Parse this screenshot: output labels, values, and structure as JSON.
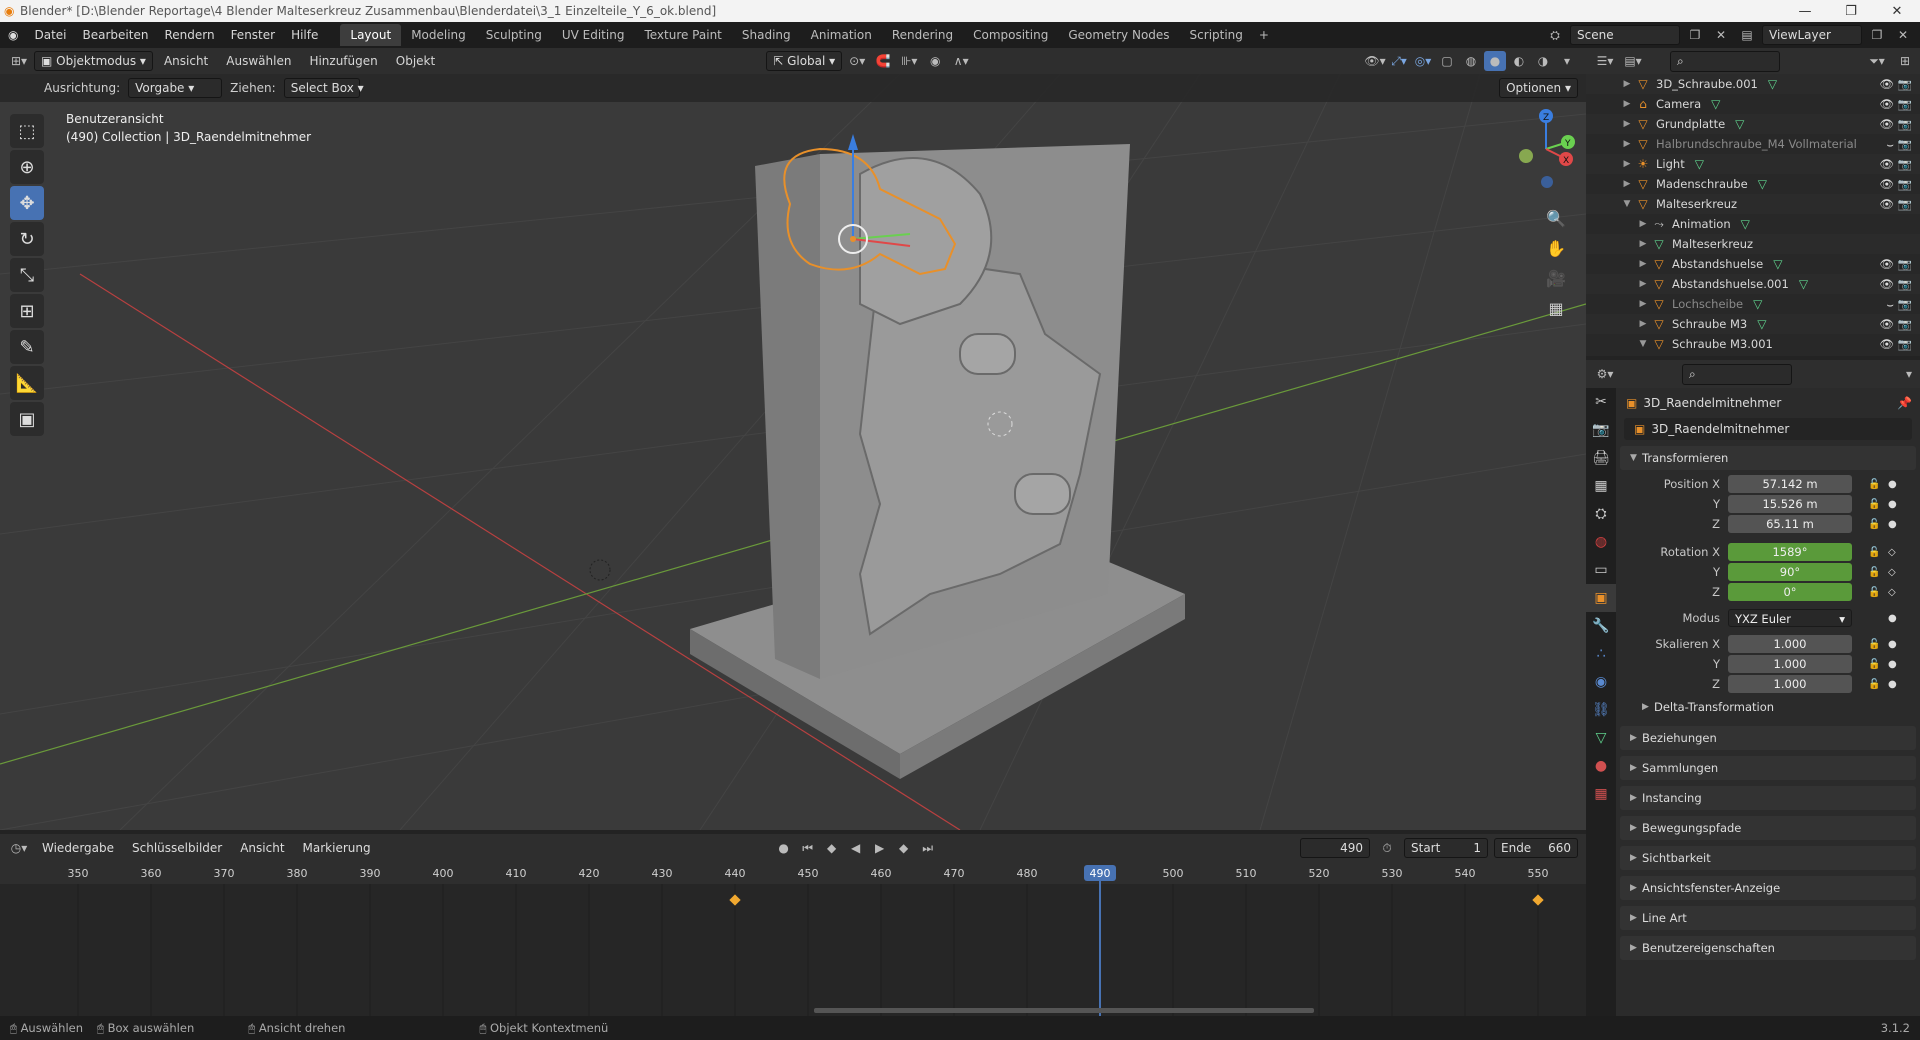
{
  "window": {
    "title": "Blender* [D:\\Blender Reportage\\4 Blender Malteserkreuz Zusammenbau\\Blenderdatei\\3_1 Einzelteile_Y_6_ok.blend]"
  },
  "menu": [
    "Datei",
    "Bearbeiten",
    "Rendern",
    "Fenster",
    "Hilfe"
  ],
  "workspaces": [
    {
      "label": "Layout",
      "active": true
    },
    {
      "label": "Modeling"
    },
    {
      "label": "Sculpting"
    },
    {
      "label": "UV Editing"
    },
    {
      "label": "Texture Paint"
    },
    {
      "label": "Shading"
    },
    {
      "label": "Animation"
    },
    {
      "label": "Rendering"
    },
    {
      "label": "Compositing"
    },
    {
      "label": "Geometry Nodes"
    },
    {
      "label": "Scripting"
    }
  ],
  "scene": {
    "name": "Scene",
    "viewlayer": "ViewLayer"
  },
  "viewport_header": {
    "mode": "Objektmodus",
    "menus": [
      "Ansicht",
      "Auswählen",
      "Hinzufügen",
      "Objekt"
    ],
    "orientation": "Global"
  },
  "tool_header": {
    "ausrichtung_label": "Ausrichtung:",
    "ausrichtung_value": "Vorgabe",
    "ziehen_label": "Ziehen:",
    "ziehen_value": "Select Box",
    "optionen": "Optionen"
  },
  "viewport_info": {
    "view": "Benutzeransicht",
    "collection": "(490) Collection | 3D_Raendelmitnehmer"
  },
  "gizmo": {
    "x": "X",
    "y": "Y",
    "z": "Z"
  },
  "outliner": {
    "items": [
      {
        "name": "3D_Schraube.001",
        "icon": "mesh-object-icon",
        "level": 0,
        "data": true,
        "visible": true
      },
      {
        "name": "Camera",
        "icon": "camera-object-icon",
        "level": 0,
        "data": true,
        "visible": true
      },
      {
        "name": "Grundplatte",
        "icon": "mesh-object-icon",
        "level": 0,
        "data": true,
        "visible": true
      },
      {
        "name": "Halbrundschraube_M4 Vollmaterial",
        "icon": "mesh-object-icon",
        "level": 0,
        "dim": true,
        "visible": false
      },
      {
        "name": "Light",
        "icon": "light-object-icon",
        "level": 0,
        "data": true,
        "visible": true
      },
      {
        "name": "Madenschraube",
        "icon": "mesh-object-icon",
        "level": 0,
        "data": true,
        "visible": true
      },
      {
        "name": "Malteserkreuz",
        "icon": "mesh-object-icon",
        "level": 0,
        "expanded": true,
        "visible": true
      },
      {
        "name": "Animation",
        "icon": "animation-icon",
        "level": 1,
        "data": true
      },
      {
        "name": "Malteserkreuz",
        "icon": "mesh-data-icon",
        "level": 1
      },
      {
        "name": "Abstandshuelse",
        "icon": "mesh-object-icon",
        "level": 1,
        "data": true,
        "visible": true
      },
      {
        "name": "Abstandshuelse.001",
        "icon": "mesh-object-icon",
        "level": 1,
        "data": true,
        "visible": true
      },
      {
        "name": "Lochscheibe",
        "icon": "mesh-object-icon",
        "level": 1,
        "dim": true,
        "data": true,
        "visible": false
      },
      {
        "name": "Schraube M3",
        "icon": "mesh-object-icon",
        "level": 1,
        "data": true,
        "visible": true
      },
      {
        "name": "Schraube M3.001",
        "icon": "mesh-object-icon",
        "level": 1,
        "expanded": true,
        "visible": true
      }
    ]
  },
  "properties": {
    "object_name": "3D_Raendelmitnehmer",
    "object_name_field": "3D_Raendelmitnehmer",
    "transform": {
      "title": "Transformieren",
      "position_label": "Position X",
      "position": [
        "57.142 m",
        "15.526 m",
        "65.11 m"
      ],
      "rotation_label": "Rotation X",
      "rotation": [
        "1589°",
        "90°",
        "0°"
      ],
      "modus_label": "Modus",
      "modus": "YXZ Euler",
      "scale_label": "Skalieren X",
      "scale": [
        "1.000",
        "1.000",
        "1.000"
      ],
      "y": "Y",
      "z": "Z",
      "delta": "Delta-Transformation"
    },
    "sections": [
      "Beziehungen",
      "Sammlungen",
      "Instancing",
      "Bewegungspfade",
      "Sichtbarkeit",
      "Ansichtsfenster-Anzeige",
      "Line Art",
      "Benutzereigenschaften"
    ]
  },
  "timeline": {
    "menus": [
      "Wiedergabe",
      "Schlüsselbilder",
      "Ansicht",
      "Markierung"
    ],
    "current_frame": "490",
    "start_label": "Start",
    "start": "1",
    "end_label": "Ende",
    "end": "660",
    "ruler": [
      "350",
      "360",
      "370",
      "380",
      "390",
      "400",
      "410",
      "420",
      "430",
      "440",
      "450",
      "460",
      "470",
      "480",
      "490",
      "500",
      "510",
      "520",
      "530",
      "540",
      "550"
    ],
    "keyframes": [
      440,
      550
    ]
  },
  "status": {
    "items": [
      "Auswählen",
      "Box auswählen",
      "Ansicht drehen",
      "Objekt Kontextmenü"
    ],
    "version": "3.1.2"
  },
  "colors": {
    "accent": "#4772b3",
    "selected_outline": "#e8902a",
    "keyframe": "#f0a830",
    "green_field": "#5a9a3a"
  }
}
